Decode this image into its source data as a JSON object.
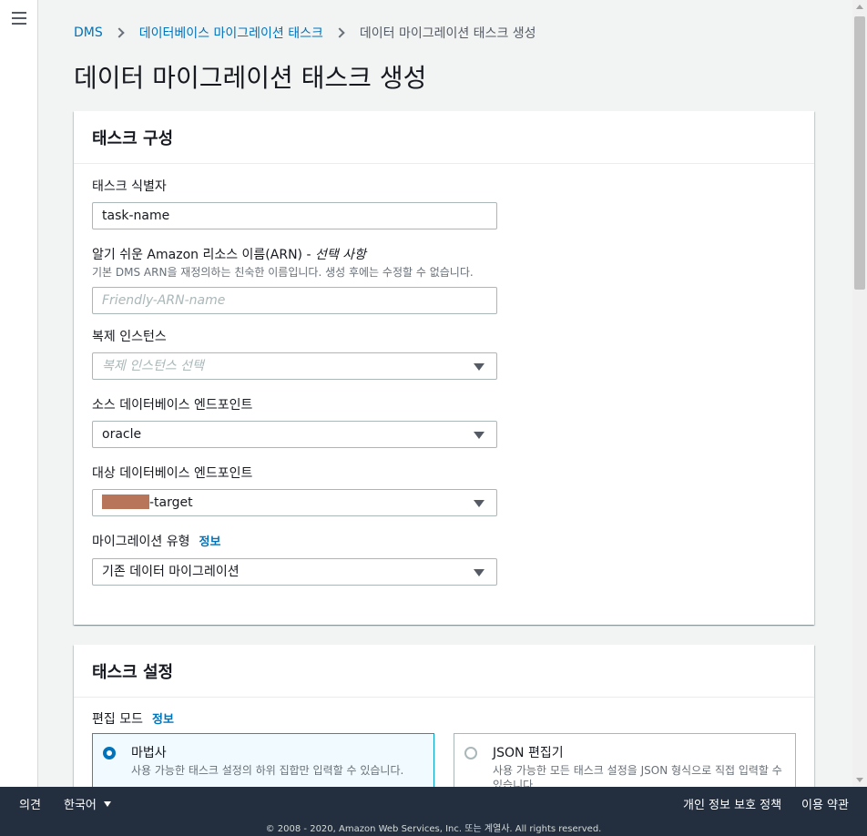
{
  "nav": {
    "menu_icon": "hamburger-menu-icon"
  },
  "breadcrumb": {
    "items": [
      "DMS",
      "데이터베이스 마이그레이션 태스크"
    ],
    "current": "데이터 마이그레이션 태스크 생성"
  },
  "page_title": "데이터 마이그레이션 태스크 생성",
  "task_config": {
    "header": "태스크 구성",
    "task_identifier": {
      "label": "태스크 식별자",
      "value": "task-name"
    },
    "friendly_arn": {
      "label": "알기 쉬운 Amazon 리소스 이름(ARN) - ",
      "optional": "선택 사항",
      "description": "기본 DMS ARN을 재정의하는 친숙한 이름입니다. 생성 후에는 수정할 수 없습니다.",
      "placeholder": "Friendly-ARN-name"
    },
    "replication_instance": {
      "label": "복제 인스턴스",
      "placeholder": "복제 인스턴스 선택"
    },
    "source_endpoint": {
      "label": "소스 데이터베이스 엔드포인트",
      "value": "oracle"
    },
    "target_endpoint": {
      "label": "대상 데이터베이스 엔드포인트",
      "value_suffix": "-target"
    },
    "migration_type": {
      "label": "마이그레이션 유형",
      "info": "정보",
      "value": "기존 데이터 마이그레이션"
    }
  },
  "task_settings": {
    "header": "태스크 설정",
    "edit_mode": {
      "label": "편집 모드",
      "info": "정보",
      "options": [
        {
          "title": "마법사",
          "description": "사용 가능한 태스크 설정의 하위 집합만 입력할 수 있습니다.",
          "selected": true
        },
        {
          "title": "JSON 편집기",
          "description": "사용 가능한 모든 태스크 설정을 JSON 형식으로 직접 입력할 수 있습니다",
          "selected": false
        }
      ]
    }
  },
  "footer": {
    "feedback": "의견",
    "language": "한국어",
    "privacy": "개인 정보 보호 정책",
    "terms": "이용 약관",
    "copyright": "© 2008 - 2020, Amazon Web Services, Inc. 또는 계열사. All rights reserved."
  },
  "colors": {
    "link": "#0073bb",
    "selected_border": "#00a1c9",
    "footer_bg": "#232f3e",
    "page_bg": "#f2f3f3"
  }
}
